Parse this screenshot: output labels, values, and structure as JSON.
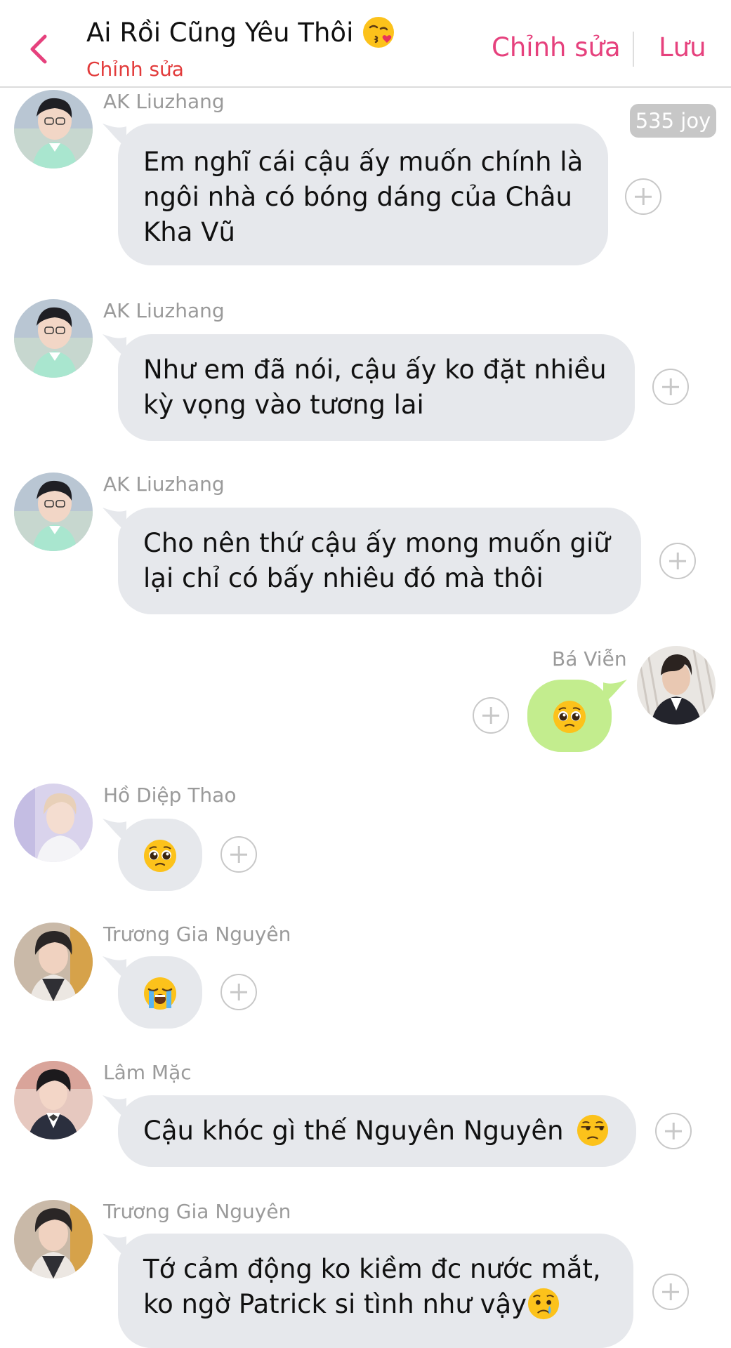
{
  "header": {
    "title": "Ai Rồi Cũng Yêu Thôi",
    "title_emoji": "kissing-face-with-heart",
    "subtitle": "Chỉnh sửa",
    "edit_label": "Chỉnh sửa",
    "save_label": "Lưu",
    "accent_color": "#e6417d",
    "subtitle_color": "#e23b3b"
  },
  "joy_badge": "535 joy",
  "messages": [
    {
      "sender": "AK Liuzhang",
      "side": "left",
      "lines": [
        "Em nghĩ cái cậu ấy muốn chính là",
        "ngôi nhà có bóng dáng của Châu",
        "Kha Vũ"
      ]
    },
    {
      "sender": "AK Liuzhang",
      "side": "left",
      "lines": [
        "Như em đã nói, cậu ấy ko đặt nhiều",
        "kỳ vọng vào tương lai"
      ]
    },
    {
      "sender": "AK Liuzhang",
      "side": "left",
      "lines": [
        "Cho nên thứ cậu ấy mong muốn giữ",
        "lại chỉ có bấy nhiêu đó mà thôi"
      ]
    },
    {
      "sender": "Bá Viễn",
      "side": "right",
      "emoji": "pleading-face"
    },
    {
      "sender": "Hồ Diệp Thao",
      "side": "left",
      "emoji": "pleading-face"
    },
    {
      "sender": "Trương Gia Nguyên",
      "side": "left",
      "emoji": "loudly-crying-face"
    },
    {
      "sender": "Lâm Mặc",
      "side": "left",
      "lines": [
        "Cậu khóc gì thế Nguyên Nguyên"
      ],
      "trailing_emoji": "unamused-face"
    },
    {
      "sender": "Trương Gia Nguyên",
      "side": "left",
      "lines": [
        "Tớ cảm động ko kiềm đc nước mắt,",
        "ko ngờ Patrick si tình như vậy"
      ],
      "trailing_emoji": "crying-face"
    }
  ],
  "colors": {
    "bubble_gray": "#e6e8ec",
    "bubble_green": "#c3ed8e",
    "sender_gray": "#9a9a9a"
  }
}
